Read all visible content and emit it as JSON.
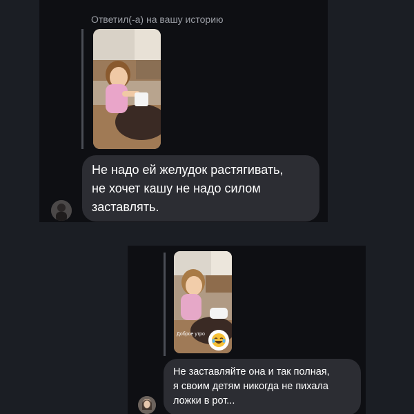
{
  "shot1": {
    "reply_label": "Ответил(-а) на вашу историю",
    "message_lines": [
      "Не надо ей желудок растягивать,",
      "не хочет кашу не надо силом",
      "заставлять."
    ]
  },
  "shot2": {
    "story_caption": "Доброе утро",
    "reaction_icon": "laughing-crying-emoji",
    "message_lines": [
      "Не заставляйте она и так полная,",
      "я своим детям никогда не пихала",
      "ложки в рот..."
    ]
  },
  "colors": {
    "page_background": "#1b1e24",
    "chat_background": "#0e0f13",
    "bubble": "#2c2d33",
    "label_text": "#9c9fa6",
    "message_text": "#ffffff"
  }
}
